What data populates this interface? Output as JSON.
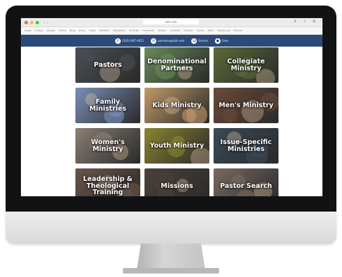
{
  "browser": {
    "traffic_lights": [
      "#f25f58",
      "#fbbe2e",
      "#38c93f"
    ],
    "tab_text": "< >",
    "url": "sbts.edu",
    "toolbar_icons": "⬆ + ⧉"
  },
  "bookmarks": [
    "Apple",
    "iCloud",
    "Google",
    "Yahoo",
    "Bing",
    "News",
    "Maps",
    "Weather",
    "Wikipedia",
    "YouTube",
    "Facebook",
    "Twitter",
    "LinkedIn",
    "Popular",
    "Travel",
    "Work",
    "Resources",
    "Events"
  ],
  "nav": {
    "items": [
      {
        "icon": "phone-icon",
        "glyph": "✆",
        "label": "(502) 897-4011"
      },
      {
        "icon": "mail-icon",
        "glyph": "✉",
        "label": "partners@sbts.edu"
      },
      {
        "icon": "calendar-icon",
        "glyph": "▤",
        "label": "Events"
      },
      {
        "icon": "user-icon",
        "glyph": "●",
        "label": "Give"
      }
    ],
    "color": "#2c4a78"
  },
  "tiles": [
    {
      "label": "Pastors",
      "bg": "#4a4f55"
    },
    {
      "label": "Denominational Partners",
      "bg": "#6b8a5a"
    },
    {
      "label": "Collegiate Ministry",
      "bg": "#5c6a38"
    },
    {
      "label": "Family Ministries",
      "bg": "#7a8fb8"
    },
    {
      "label": "Kids Ministry",
      "bg": "#c29a6a"
    },
    {
      "label": "Men's Ministry",
      "bg": "#6b4a38"
    },
    {
      "label": "Women's Ministry",
      "bg": "#8a7f75"
    },
    {
      "label": "Youth Ministry",
      "bg": "#8a8530"
    },
    {
      "label": "Issue-Specific Ministries",
      "bg": "#3a4a58"
    },
    {
      "label": "Leadership & Theological Training",
      "bg": "#6a5548"
    },
    {
      "label": "Missions",
      "bg": "#4a4038"
    },
    {
      "label": "Pastor Search",
      "bg": "#7a6a60"
    }
  ]
}
